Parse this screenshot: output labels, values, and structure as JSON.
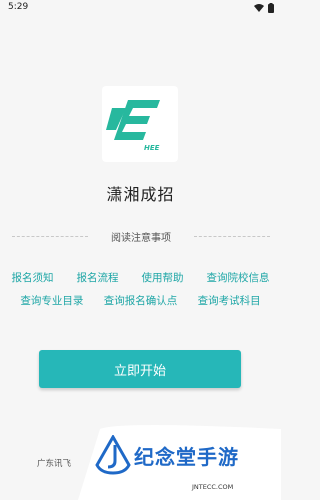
{
  "status": {
    "time": "5:29"
  },
  "app": {
    "name": "潇湘成招",
    "logo_text": "HEE"
  },
  "notice": {
    "label": "阅读注意事项"
  },
  "links": {
    "row1": [
      "报名须知",
      "报名流程",
      "使用帮助",
      "查询院校信息"
    ],
    "row2": [
      "查询专业目录",
      "查询报名确认点",
      "查询考试科目"
    ]
  },
  "start_button": {
    "label": "立即开始"
  },
  "footer": {
    "text": "广东讯飞"
  },
  "watermark": {
    "name": "纪念堂手游",
    "url": "JNTECC.COM",
    "accent": "#1f69c7"
  },
  "colors": {
    "accent": "#26b7b8",
    "link": "#1ea6a6",
    "logo_green": "#27b89e"
  }
}
